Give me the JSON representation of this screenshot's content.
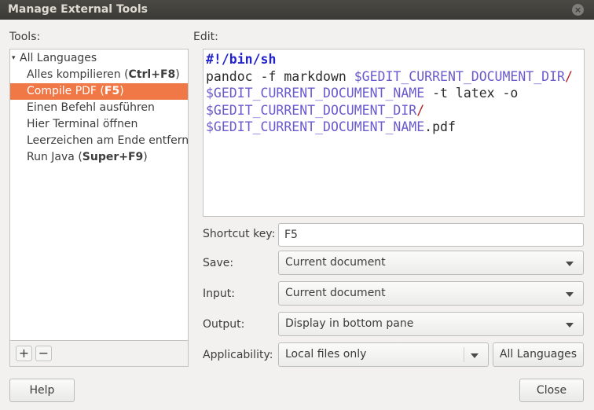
{
  "window": {
    "title": "Manage External Tools",
    "close_glyph": "×"
  },
  "tools": {
    "label": "Tools:",
    "root": {
      "arrow": "▾",
      "label": "All Languages"
    },
    "items": [
      {
        "label": "Alles kompilieren (",
        "shortcut": "Ctrl+F8",
        "suffix": ")"
      },
      {
        "label": "Compile PDF (",
        "shortcut": "F5",
        "suffix": ")"
      },
      {
        "label": "Einen Befehl ausführen",
        "shortcut": "",
        "suffix": ""
      },
      {
        "label": "Hier Terminal öffnen",
        "shortcut": "",
        "suffix": ""
      },
      {
        "label": "Leerzeichen am Ende entfernen",
        "shortcut": "",
        "suffix": ""
      },
      {
        "label": "Run Java (",
        "shortcut": "Super+F9",
        "suffix": ")"
      }
    ],
    "selected_index": 1,
    "add_label": "+",
    "remove_label": "−"
  },
  "edit": {
    "label": "Edit:",
    "line1": "#!/bin/sh",
    "line2_a": "pandoc -f markdown ",
    "var_dir": "$GEDIT_CURRENT_DOCUMENT_DIR",
    "slash": "/",
    "var_name": "$GEDIT_CURRENT_DOCUMENT_NAME",
    "line3_b": " -t latex -o",
    "line5_ext": ".pdf"
  },
  "fields": {
    "shortcut_label": "Shortcut key:",
    "shortcut_value": "F5",
    "save_label": "Save:",
    "save_value": "Current document",
    "input_label": "Input:",
    "input_value": "Current document",
    "output_label": "Output:",
    "output_value": "Display in bottom pane",
    "applicability_label": "Applicability:",
    "applicability_value": "Local files only",
    "languages_button": "All Languages"
  },
  "footer": {
    "help_label": "Help",
    "close_label": "Close"
  },
  "colors": {
    "selection": "#f07746",
    "titlebar": "#3b3a36",
    "shebang": "#2222cc",
    "variable": "#6a5acd"
  }
}
